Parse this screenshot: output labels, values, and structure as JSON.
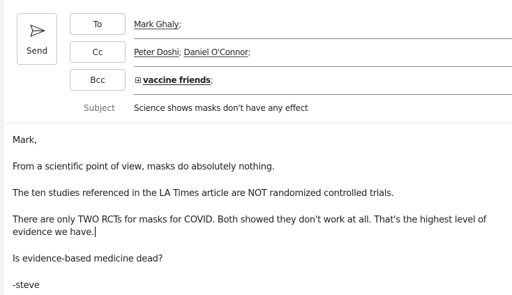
{
  "send": {
    "label": "Send",
    "icon": "send-icon"
  },
  "to": {
    "button_label": "To",
    "recipients": [
      "Mark Ghaly"
    ]
  },
  "cc": {
    "button_label": "Cc",
    "recipients": [
      "Peter Doshi",
      "Daniel O'Connor"
    ]
  },
  "bcc": {
    "button_label": "Bcc",
    "group": "vaccine friends"
  },
  "separator": ";",
  "subject": {
    "label": "Subject",
    "value": "Science shows masks don't have any effect"
  },
  "body": {
    "greeting": "Mark,",
    "p1": "From a scientific point of view, masks do absolutely nothing.",
    "p2": "The ten studies referenced in the LA Times article are NOT randomized controlled trials.",
    "p3": "There are only TWO RCTs for masks for COVID. Both showed they don't work at all. That's the highest level of evidence we have.",
    "p4": "Is evidence-based medicine dead?",
    "signature": "-steve"
  }
}
